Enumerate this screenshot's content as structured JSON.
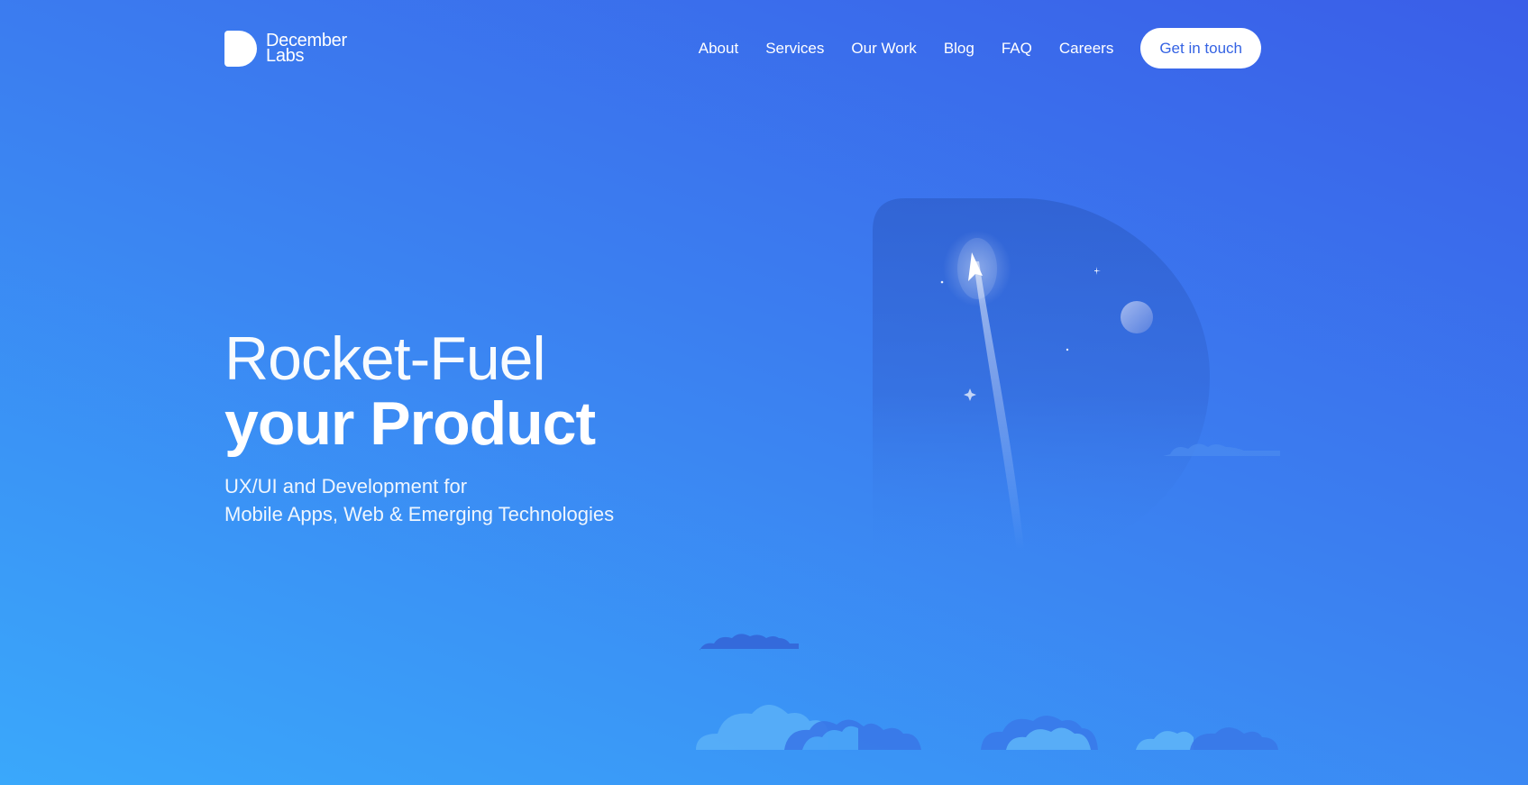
{
  "brand": {
    "name_line1": "December",
    "name_line2": "Labs"
  },
  "nav": {
    "items": [
      "About",
      "Services",
      "Our Work",
      "Blog",
      "FAQ",
      "Careers"
    ],
    "cta_label": "Get in touch"
  },
  "hero": {
    "title_line1": "Rocket-Fuel",
    "title_line2": "your Product",
    "subtitle_line1": "UX/UI and Development for",
    "subtitle_line2": "Mobile Apps, Web & Emerging Technologies"
  },
  "colors": {
    "background_top": "#3a5ee8",
    "background_bottom": "#3aa8fb",
    "accent": "#3563e3",
    "white": "#ffffff"
  },
  "icons": {
    "logo": "december-labs-d-logo",
    "illustration": "d-shape-rocket-illustration"
  }
}
